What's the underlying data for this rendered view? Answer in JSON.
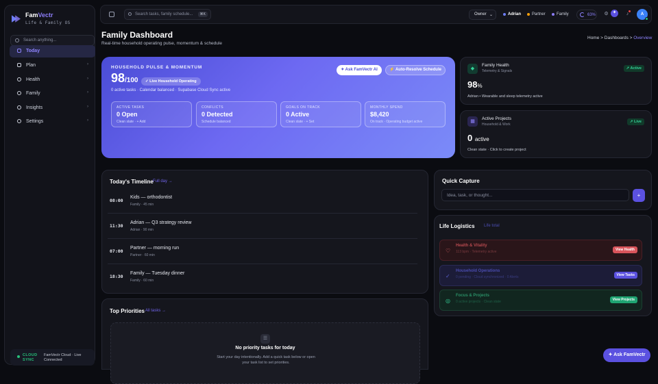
{
  "sidebar": {
    "brand_a": "Fam",
    "brand_b": "Vectr",
    "tagline": "Life & Family OS",
    "search_placeholder": "Search anything...",
    "items": [
      {
        "label": "Today"
      },
      {
        "label": "Plan"
      },
      {
        "label": "Health"
      },
      {
        "label": "Family"
      },
      {
        "label": "Insights"
      },
      {
        "label": "Settings"
      }
    ],
    "sync_label_1": "CLOUD",
    "sync_label_2": "SYNC",
    "sync_text_1": "FamVectr Cloud · Live",
    "sync_text_2": "Connected"
  },
  "topbar": {
    "search_placeholder": "Search tasks, family schedule...",
    "kbd": "⌘K",
    "role": "Owner",
    "members": [
      {
        "name": "Adrian",
        "color": "#6d7df7"
      },
      {
        "name": "Partner",
        "color": "#f59e0b"
      },
      {
        "name": "Family",
        "color": "#8b7cf6"
      }
    ],
    "progress": "63%",
    "avatar": "A"
  },
  "page": {
    "title": "Family Dashboard",
    "subtitle": "Real-time household operating pulse, momentum & schedule",
    "crumbs": [
      "Home",
      "Dashboards",
      "Overview"
    ],
    "sep": ">"
  },
  "hero": {
    "kicker": "HOUSEHOLD PULSE & MOMENTUM",
    "score": "98",
    "score_max": "/100",
    "pill": "✓ Live Household Operating",
    "summary": "0 active tasks · Calendar balanced · Supabase Cloud Sync active",
    "ask_btn": "✦ Ask FamVectr AI",
    "resolve_btn": "⚡ Auto-Resolve Schedule",
    "stats": [
      {
        "key": "ACTIVE TASKS",
        "value": "0 Open",
        "sub": "Clean slate · + Add"
      },
      {
        "key": "CONFLICTS",
        "value": "0 Detected",
        "sub": "Schedule balanced"
      },
      {
        "key": "GOALS ON TRACK",
        "value": "0 Active",
        "sub": "Clean slate · + Set"
      },
      {
        "key": "MONTHLY SPEND",
        "value": "$8,420",
        "sub": "On track · Operating budget active"
      }
    ]
  },
  "health_card": {
    "title": "Family Health",
    "sub": "Telemetry & Signals",
    "badge": "↗ Active",
    "value": "98",
    "unit": "%",
    "caption": "Adrian • Wearable and sleep telemetry active"
  },
  "projects_card": {
    "title": "Active Projects",
    "sub": "Household & Work",
    "badge": "↗ Live",
    "value": "0",
    "unit": "active",
    "caption": "Clean state · Click to create project"
  },
  "timeline": {
    "title": "Today's Timeline",
    "link": "Full day →",
    "rows": [
      {
        "time": "08:00",
        "name": "Kids — orthodontist",
        "sub": "Family · 45 min"
      },
      {
        "time": "11:30",
        "name": "Adrian — Q3 strategy review",
        "sub": "Adrian · 90 min"
      },
      {
        "time": "07:00",
        "name": "Partner — morning run",
        "sub": "Partner · 60 min"
      },
      {
        "time": "18:30",
        "name": "Family — Tuesday dinner",
        "sub": "Family · 60 min"
      }
    ]
  },
  "priorities": {
    "title": "Top Priorities",
    "link": "All tasks →",
    "empty_title": "No priority tasks for today",
    "empty_body": "Start your day intentionally. Add a quick task below or open your task list to set priorities."
  },
  "quick_capture": {
    "title": "Quick Capture",
    "placeholder": "Idea, task, or thought...",
    "btn": "+"
  },
  "logistics": {
    "title": "Life Logistics",
    "link": "Life total",
    "items": [
      {
        "name": "Health & Vitality",
        "sub": "113 bpm · Telemetry active",
        "btn": "View Health",
        "icon": "♡"
      },
      {
        "name": "Household Operations",
        "sub": "0 pending · Cloud synchronized · 0 Alerts",
        "btn": "View Tasks",
        "icon": "✓"
      },
      {
        "name": "Focus & Projects",
        "sub": "0 active projects · Clean state",
        "btn": "View Projects",
        "icon": "◎"
      }
    ]
  },
  "fab": "✦ Ask FamVectr"
}
